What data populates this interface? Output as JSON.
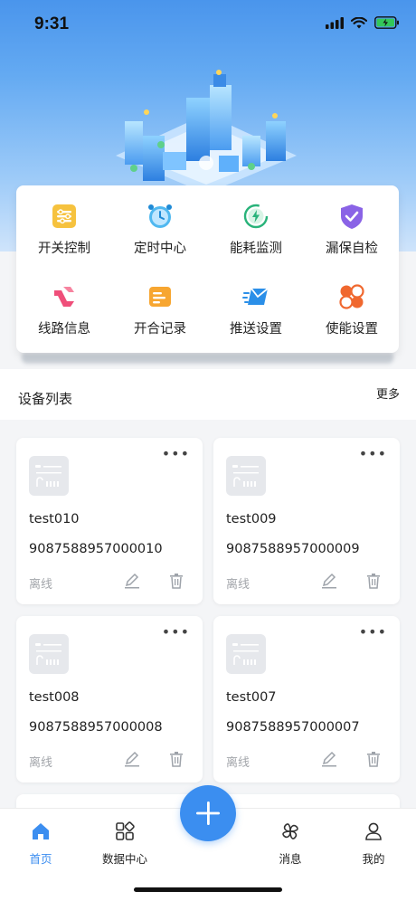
{
  "status_bar": {
    "time": "9:31"
  },
  "quick_menu": [
    {
      "label": "开关控制",
      "icon": "switch-control-icon"
    },
    {
      "label": "定时中心",
      "icon": "alarm-clock-icon"
    },
    {
      "label": "能耗监测",
      "icon": "energy-icon"
    },
    {
      "label": "漏保自检",
      "icon": "shield-check-icon"
    },
    {
      "label": "线路信息",
      "icon": "line-info-icon"
    },
    {
      "label": "开合记录",
      "icon": "record-icon"
    },
    {
      "label": "推送设置",
      "icon": "push-icon"
    },
    {
      "label": "使能设置",
      "icon": "enable-icon"
    }
  ],
  "device_list": {
    "title": "设备列表",
    "more": "更多",
    "devices": [
      {
        "name": "test010",
        "code": "9087588957000010",
        "status": "离线"
      },
      {
        "name": "test009",
        "code": "9087588957000009",
        "status": "离线"
      },
      {
        "name": "test008",
        "code": "9087588957000008",
        "status": "离线"
      },
      {
        "name": "test007",
        "code": "9087588957000007",
        "status": "离线"
      }
    ],
    "more_dots": "•••"
  },
  "tabbar": {
    "tabs": [
      {
        "label": "首页",
        "icon": "home-icon"
      },
      {
        "label": "数据中心",
        "icon": "grid-icon"
      },
      {
        "label": "消息",
        "icon": "clover-icon"
      },
      {
        "label": "我的",
        "icon": "user-icon"
      }
    ],
    "fab_icon": "plus-icon"
  },
  "colors": {
    "accent": "#3b8ef0",
    "hero_top": "#4a95ec",
    "muted": "#a3a6ab"
  }
}
